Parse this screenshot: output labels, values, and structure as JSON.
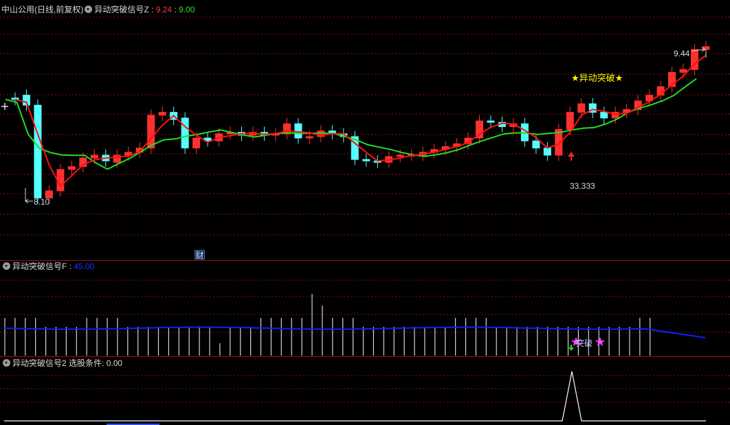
{
  "panel1": {
    "stock_name": "中山公用",
    "period": "(日线,前复权)",
    "indicator": "异动突破信号Z",
    "sep": ":",
    "value_red": "9.24",
    "value_green": "9.00",
    "label_high": "9.44",
    "label_low": "8.10",
    "signal_text": "★异动突破★",
    "value_33": "33.333",
    "cai_badge": "财",
    "colors": {
      "up": "#ff3030",
      "down": "#54ffff",
      "ma_fast": "#ff1010",
      "ma_slow": "#22dd22",
      "signal": "#ffff00"
    }
  },
  "panel2": {
    "indicator": "异动突破信号F",
    "sep": ":",
    "value": "45.00",
    "signal_text": "突破",
    "colors": {
      "line": "#1020ff",
      "bars": "#d0d0d0",
      "signal": "#ff44ff"
    }
  },
  "panel3": {
    "indicator": "异动突破信号2",
    "condition_label": "选股条件:",
    "value": "0.00"
  },
  "chart_data": [
    {
      "type": "candlestick",
      "series": [
        {
          "name": "candles",
          "open": [
            8.9,
            8.92,
            8.85,
            8.2,
            8.25,
            8.4,
            8.42,
            8.48,
            8.5,
            8.45,
            8.5,
            8.52,
            8.55,
            8.78,
            8.8,
            8.76,
            8.55,
            8.62,
            8.6,
            8.65,
            8.66,
            8.64,
            8.66,
            8.64,
            8.65,
            8.72,
            8.62,
            8.63,
            8.67,
            8.65,
            8.63,
            8.47,
            8.46,
            8.45,
            8.49,
            8.5,
            8.5,
            8.52,
            8.54,
            8.56,
            8.58,
            8.62,
            8.74,
            8.73,
            8.7,
            8.72,
            8.6,
            8.55,
            8.5,
            8.68,
            8.8,
            8.86,
            8.8,
            8.76,
            8.8,
            8.82,
            8.88,
            8.92,
            8.98,
            9.08,
            9.1,
            9.24
          ],
          "close": [
            8.89,
            8.85,
            8.2,
            8.25,
            8.4,
            8.42,
            8.48,
            8.5,
            8.46,
            8.5,
            8.52,
            8.55,
            8.78,
            8.8,
            8.75,
            8.55,
            8.62,
            8.6,
            8.65,
            8.66,
            8.64,
            8.66,
            8.64,
            8.65,
            8.72,
            8.62,
            8.63,
            8.67,
            8.65,
            8.63,
            8.47,
            8.46,
            8.45,
            8.49,
            8.5,
            8.5,
            8.52,
            8.54,
            8.56,
            8.58,
            8.62,
            8.74,
            8.73,
            8.7,
            8.72,
            8.6,
            8.55,
            8.5,
            8.68,
            8.8,
            8.86,
            8.8,
            8.76,
            8.8,
            8.82,
            8.88,
            8.92,
            8.98,
            9.08,
            9.1,
            9.24,
            9.26
          ]
        }
      ],
      "ylim": [
        8.0,
        9.5
      ]
    }
  ]
}
